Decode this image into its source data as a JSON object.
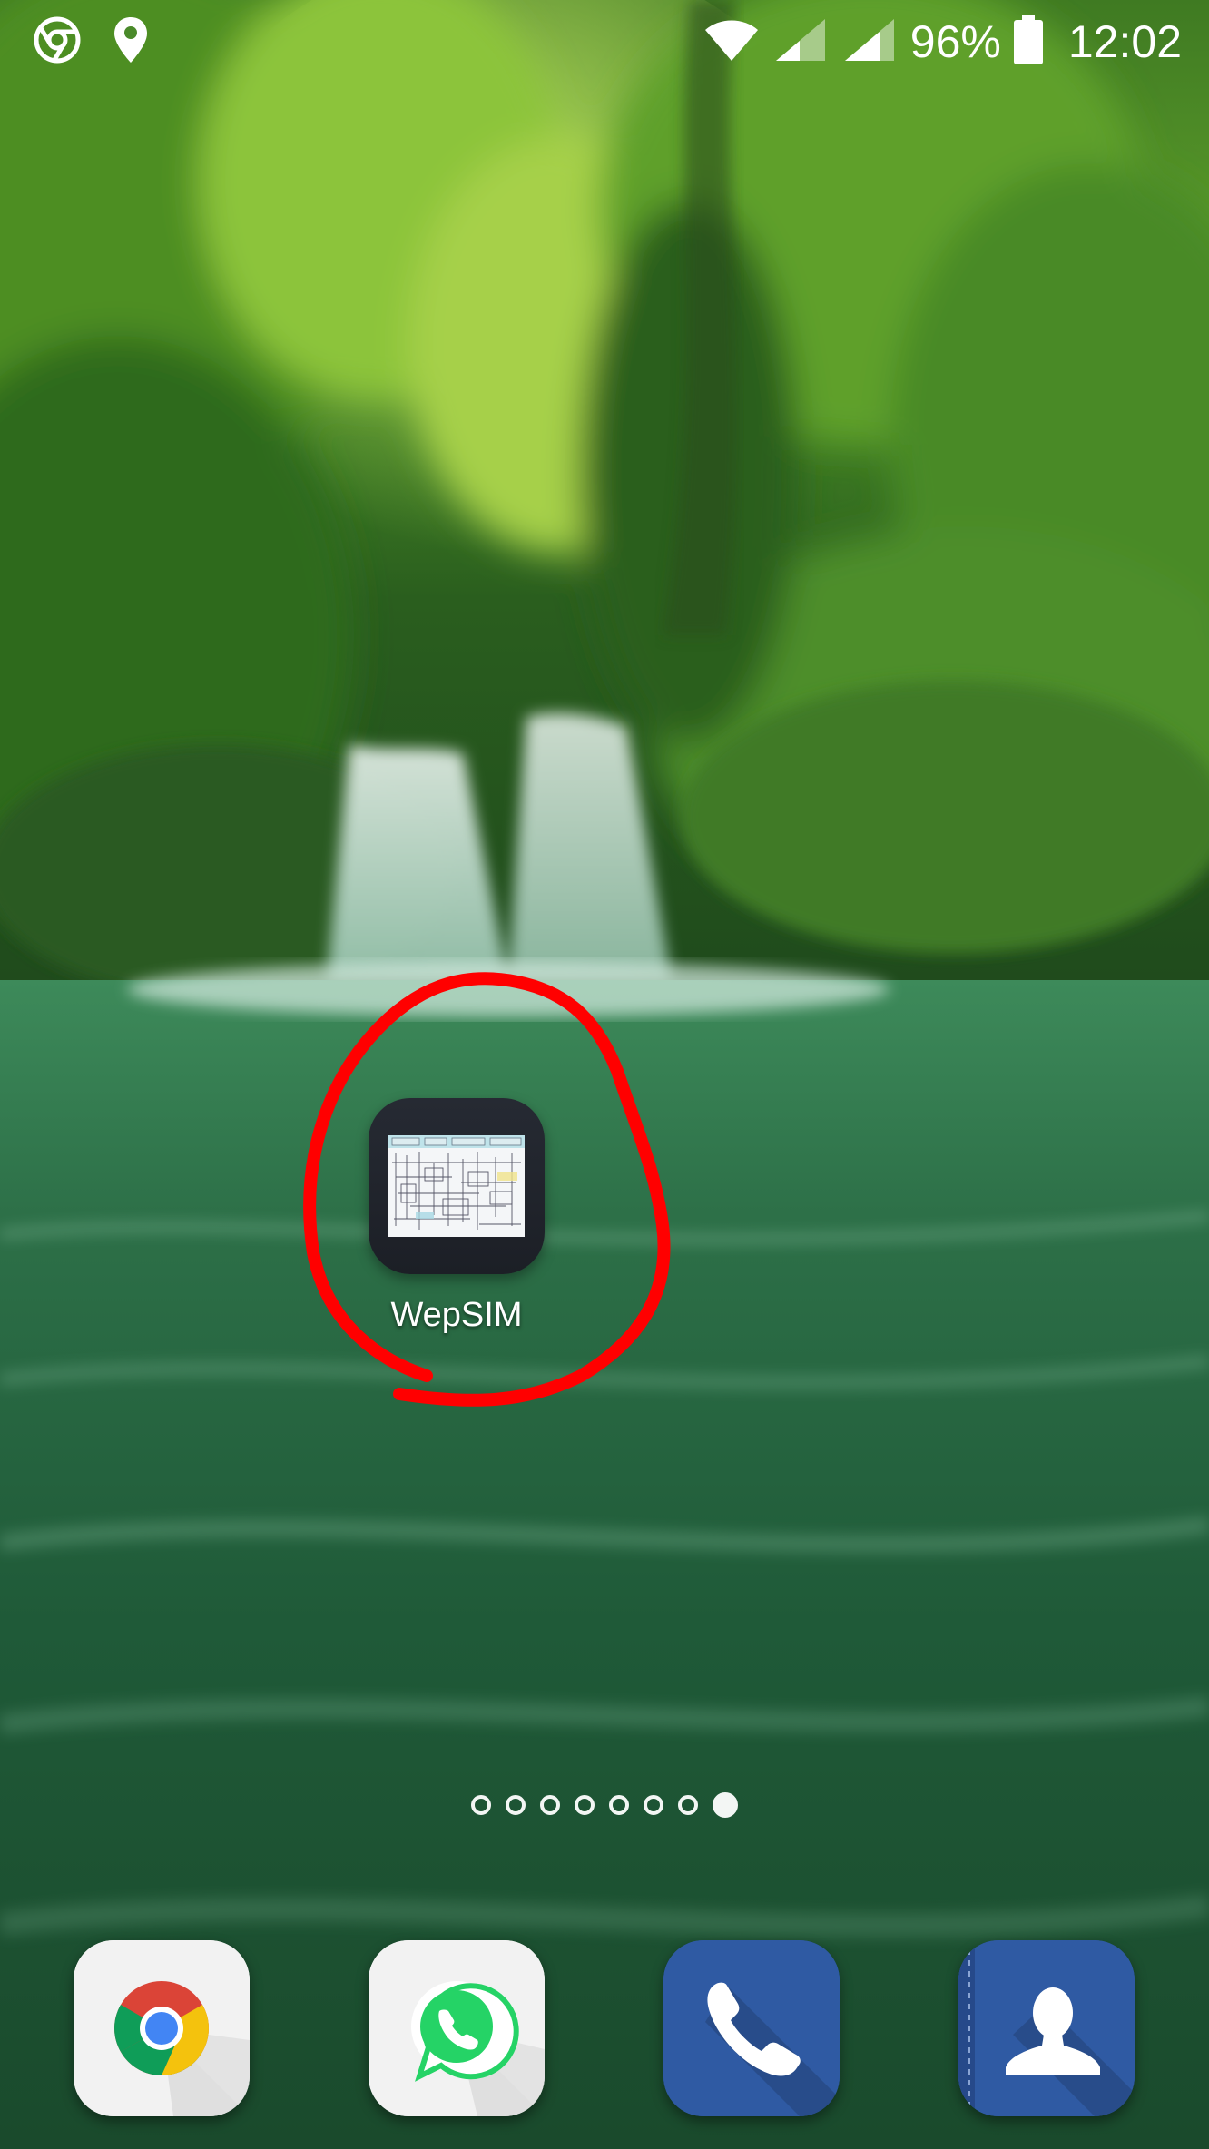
{
  "status_bar": {
    "left_icons": [
      "chrome-notification-icon",
      "location-icon"
    ],
    "battery_percent": "96%",
    "time": "12:02",
    "right_icons": [
      "wifi-icon",
      "signal-icon",
      "signal-icon",
      "battery-icon"
    ]
  },
  "home_screen": {
    "shortcut": {
      "label": "WepSIM",
      "icon": "wepsim-app-icon"
    },
    "annotation": {
      "shape": "hand-drawn circle",
      "color": "#ff0000"
    },
    "page_indicator": {
      "page_count": 8,
      "active_page": 8
    }
  },
  "dock": {
    "apps": [
      {
        "name": "Chrome",
        "icon": "chrome-icon"
      },
      {
        "name": "WhatsApp",
        "icon": "whatsapp-icon"
      },
      {
        "name": "Phone",
        "icon": "phone-icon"
      },
      {
        "name": "Contacts",
        "icon": "contacts-icon"
      }
    ]
  },
  "colors": {
    "annotation_red": "#ff0000",
    "dock_blue": "#2f5aa3",
    "whatsapp_green": "#25d366"
  }
}
